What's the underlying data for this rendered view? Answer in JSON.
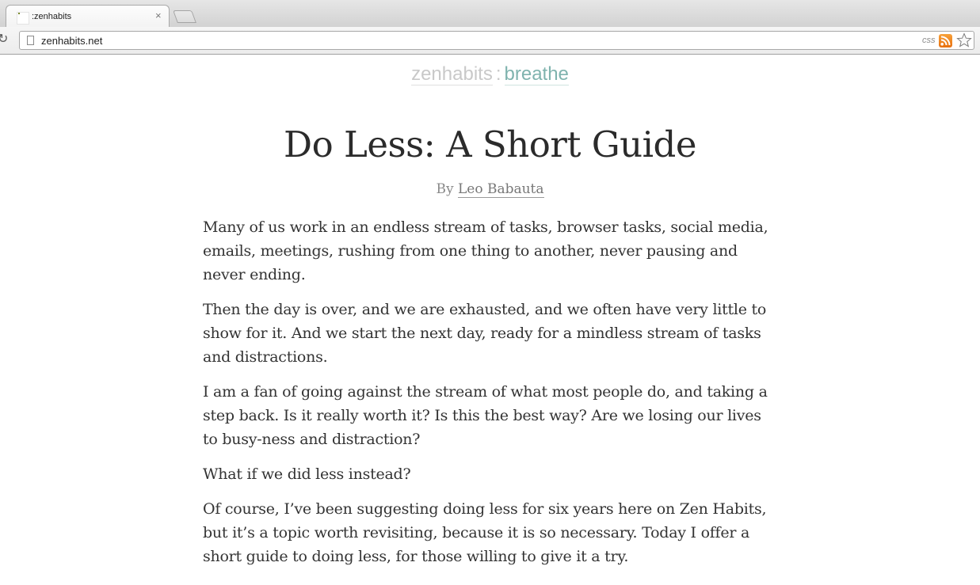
{
  "browser": {
    "tab_title": ":zenhabits",
    "tab_close": "×",
    "url": "zenhabits.net",
    "css_extension_label": "css"
  },
  "site": {
    "name": "zenhabits",
    "separator": ":",
    "tagline": "breathe"
  },
  "post": {
    "title": "Do Less: A Short Guide",
    "byline_prefix": "By",
    "author": "Leo Babauta",
    "paragraphs": [
      "Many of us work in an endless stream of tasks, browser tasks, social media, emails, meetings, rushing from one thing to another, never pausing and never ending.",
      "Then the day is over, and we are exhausted, and we often have very little to show for it. And we start the next day, ready for a mindless stream of tasks and distractions.",
      "I am a fan of going against the stream of what most people do, and taking a step back. Is it really worth it? Is this the best way? Are we losing our lives to busy-ness and distraction?",
      "What if we did less instead?",
      "Of course, I’ve been suggesting doing less for six years here on Zen Habits, but it’s a topic worth revisiting, because it is so necessary. Today I offer a short guide to doing less, for those willing to give it a try."
    ]
  },
  "colors": {
    "site_name": "#c9c9c9",
    "tagline": "#7fb3ae",
    "title": "#2b2b2b",
    "body_text": "#333333",
    "rss": "#f18a20"
  }
}
